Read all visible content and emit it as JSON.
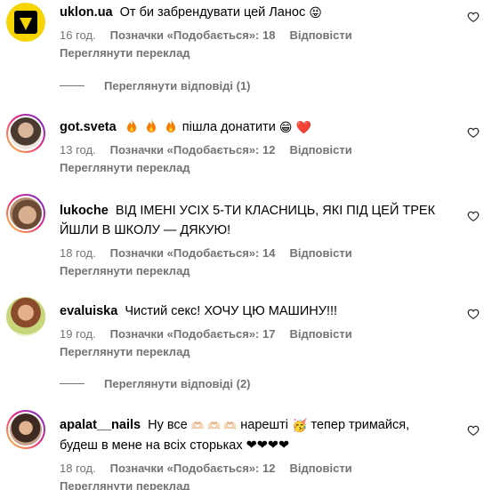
{
  "comments": [
    {
      "username": "uklon.ua",
      "text": "От би забрендувати цей Ланос",
      "emoji_after": "😝",
      "time": "16 год.",
      "likes": "Позначки «Подобається»: 18",
      "reply": "Відповісти",
      "translate": "Переглянути переклад",
      "avatar_color": "#f5d400"
    },
    {
      "username": "got.sveta",
      "text_after_flames": "пішла донатити",
      "emoji_after": "😁",
      "heart_emoji": "❤️",
      "time": "13 год.",
      "likes": "Позначки «Подобається»: 12",
      "reply": "Відповісти",
      "translate": "Переглянути переклад"
    },
    {
      "username": "lukoche",
      "text_line1": "ВІД ІМЕНІ УСІХ 5-ТИ КЛАСНИЦЬ, ЯКІ ПІД ЦЕЙ ТРЕК",
      "text_line2": "ЙШЛИ В ШКОЛУ — ДЯКУЮ!",
      "time": "18 год.",
      "likes": "Позначки «Подобається»: 14",
      "reply": "Відповісти",
      "translate": "Переглянути переклад"
    },
    {
      "username": "evaluiska",
      "text": "Чистий секс! ХОЧУ ЦЮ МАШИНУ!!!",
      "time": "19 год.",
      "likes": "Позначки «Подобається»: 17",
      "reply": "Відповісти",
      "translate": "Переглянути переклад"
    },
    {
      "username": "apalat__nails",
      "text_part1": "Ну все",
      "hearts_hands": "🫶🏻 🫶🏻 🫶🏻",
      "text_part2": "нарешті",
      "party_emoji": "🥳",
      "text_part3": "тепер тримайся,",
      "text_line2": "будеш в мене на всіх сторьках ❤❤❤❤",
      "time": "18 год.",
      "likes": "Позначки «Подобається»: 12",
      "reply": "Відповісти",
      "translate": "Переглянути переклад"
    }
  ],
  "replies_1": "Переглянути відповіді (1)",
  "replies_2": "Переглянути відповіді (2)",
  "colors": {
    "secondary_text": "#737373",
    "primary_text": "#000000",
    "story_ring_start": "#f9ce34",
    "story_ring_end": "#6228d7"
  }
}
